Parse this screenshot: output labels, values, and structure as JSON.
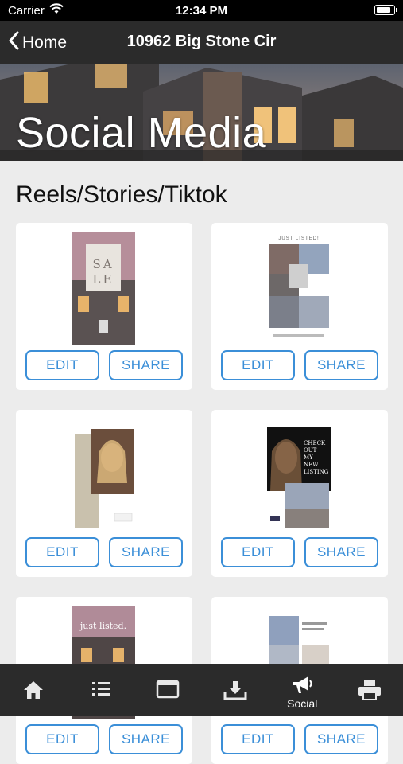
{
  "status_bar": {
    "carrier": "Carrier",
    "time": "12:34 PM",
    "battery_level": 0.9
  },
  "nav": {
    "back_label": "Home",
    "title": "10962 Big Stone Cir"
  },
  "banner": {
    "title": "Social Media"
  },
  "section": {
    "title": "Reels/Stories/Tiktok"
  },
  "cards": [
    {
      "template": "for-sale",
      "overlay_text": "SALE",
      "edit_label": "EDIT",
      "share_label": "SHARE"
    },
    {
      "template": "just-listed-grid",
      "overlay_text": "JUST LISTED!",
      "edit_label": "EDIT",
      "share_label": "SHARE"
    },
    {
      "template": "agent-portrait",
      "overlay_text": "",
      "edit_label": "EDIT",
      "share_label": "SHARE"
    },
    {
      "template": "check-out-listing",
      "overlay_text": "CHECK OUT MY NEW LISTING",
      "edit_label": "EDIT",
      "share_label": "SHARE"
    },
    {
      "template": "just-listed-photo",
      "overlay_text": "just listed.",
      "edit_label": "EDIT",
      "share_label": "SHARE"
    },
    {
      "template": "just-listed-collage",
      "overlay_text": "",
      "edit_label": "EDIT",
      "share_label": "SHARE"
    }
  ],
  "tabs": [
    {
      "icon": "home-icon",
      "label": "",
      "active": false
    },
    {
      "icon": "list-icon",
      "label": "",
      "active": false
    },
    {
      "icon": "browser-window-icon",
      "label": "",
      "active": false
    },
    {
      "icon": "download-icon",
      "label": "",
      "active": false
    },
    {
      "icon": "megaphone-icon",
      "label": "Social",
      "active": true
    },
    {
      "icon": "printer-icon",
      "label": "",
      "active": false
    }
  ],
  "colors": {
    "accent": "#3b8fd8",
    "bar": "#2b2b2b",
    "background": "#ececec"
  }
}
